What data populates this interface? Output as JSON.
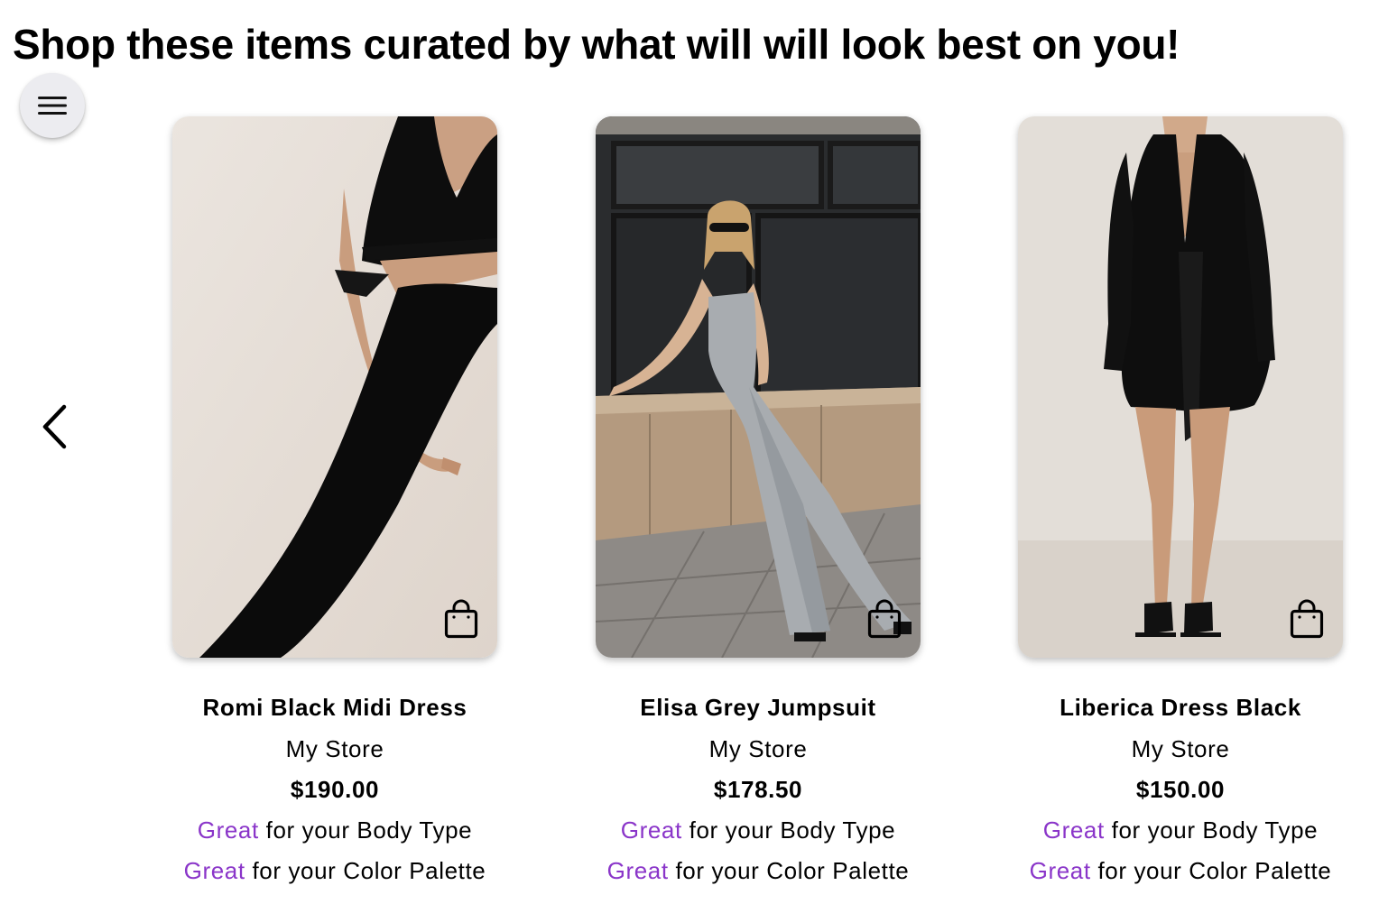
{
  "header": {
    "title": "Shop these items curated by what will will look best on you!"
  },
  "nav": {
    "menu_icon": "hamburger-menu-icon",
    "prev_icon": "chevron-left-icon"
  },
  "colors": {
    "accent": "#8a35c9",
    "text": "#000000",
    "menu_bg": "#ececf0"
  },
  "products": [
    {
      "name": "Romi Black Midi Dress",
      "store": "My Store",
      "price": "$190.00",
      "body_rating": "Great",
      "body_text": "for your Body Type",
      "color_rating": "Great",
      "color_text": "for your Color Palette",
      "icon": "shopping-bag-icon"
    },
    {
      "name": "Elisa Grey Jumpsuit",
      "store": "My Store",
      "price": "$178.50",
      "body_rating": "Great",
      "body_text": "for your Body Type",
      "color_rating": "Great",
      "color_text": "for your Color Palette",
      "icon": "shopping-bag-icon"
    },
    {
      "name": "Liberica Dress Black",
      "store": "My Store",
      "price": "$150.00",
      "body_rating": "Great",
      "body_text": "for your Body Type",
      "color_rating": "Great",
      "color_text": "for your Color Palette",
      "icon": "shopping-bag-icon"
    }
  ]
}
